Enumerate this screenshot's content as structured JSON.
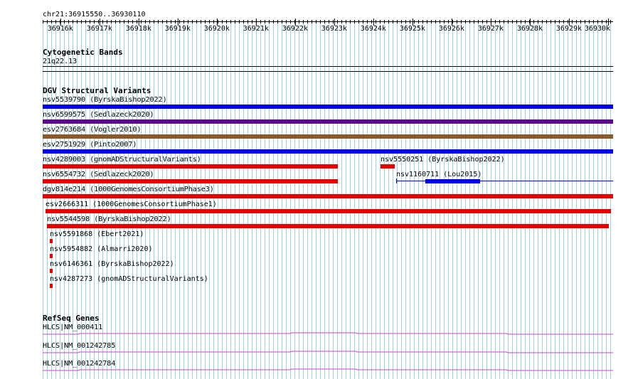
{
  "ruler": {
    "position": "chr21:36915550..36930110",
    "ticks": [
      "36916k",
      "36917k",
      "36918k",
      "36919k",
      "36920k",
      "36921k",
      "36922k",
      "36923k",
      "36924k",
      "36925k",
      "36926k",
      "36927k",
      "36928k",
      "36929k",
      "36930k"
    ]
  },
  "cytoband": {
    "title": "Cytogenetic Bands",
    "band": "21q22.13"
  },
  "dgv": {
    "title": "DGV Structural Variants",
    "features": [
      {
        "id": "nsv5539790",
        "label": "nsv5539790 (ByrskaBishop2022)",
        "color": "#0000e6"
      },
      {
        "id": "nsv6599575",
        "label": "nsv6599575 (Sedlazeck2020)",
        "color": "#5b0a8a"
      },
      {
        "id": "esv2763684",
        "label": "esv2763684 (Vogler2010)",
        "color": "#8b5a2b"
      },
      {
        "id": "esv2751929",
        "label": "esv2751929 (Pinto2007)",
        "color": "#0000e6"
      },
      {
        "id": "nsv4289003",
        "label": "nsv4289003 (gnomADStructuralVariants)",
        "color": "#e60000"
      },
      {
        "id": "nsv5550251",
        "label": "nsv5550251 (ByrskaBishop2022)",
        "color": "#e60000"
      },
      {
        "id": "nsv6554732",
        "label": "nsv6554732 (Sedlazeck2020)",
        "color": "#e60000"
      },
      {
        "id": "nsv1160711",
        "label": "nsv1160711 (Lou2015)",
        "color": "#0000e6"
      },
      {
        "id": "dgv814e214",
        "label": "dgv814e214 (1000GenomesConsortiumPhase3)",
        "color": "#e60000"
      },
      {
        "id": "esv2666311",
        "label": "esv2666311 (1000GenomesConsortiumPhase1)",
        "color": "#e60000"
      },
      {
        "id": "nsv5544598",
        "label": "nsv5544598 (ByrskaBishop2022)",
        "color": "#e60000"
      },
      {
        "id": "nsv5591868",
        "label": "nsv5591868 (Ebert2021)",
        "color": "#e60000"
      },
      {
        "id": "nsv5954882",
        "label": "nsv5954882 (Almarri2020)",
        "color": "#e60000"
      },
      {
        "id": "nsv6146361",
        "label": "nsv6146361 (ByrskaBishop2022)",
        "color": "#e60000"
      },
      {
        "id": "nsv4287273",
        "label": "nsv4287273 (gnomADStructuralVariants)",
        "color": "#e60000"
      }
    ]
  },
  "refseq": {
    "title": "RefSeq Genes",
    "genes": [
      {
        "label": "HLCS|NM_000411"
      },
      {
        "label": "HLCS|NM_001242785"
      },
      {
        "label": "HLCS|NM_001242784"
      }
    ],
    "color": "#cc44cc"
  },
  "colors": {
    "grid": "#9fd3dc",
    "background": "#ffffff"
  }
}
